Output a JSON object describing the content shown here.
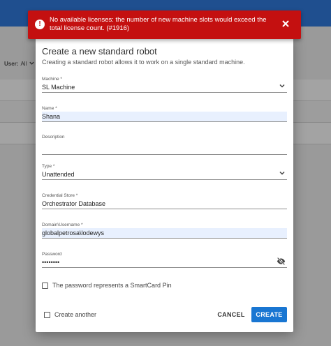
{
  "background": {
    "filter_label": "User:",
    "filter_value": "All"
  },
  "error": {
    "message": "No available licenses: the number of new machine slots would exceed the total license count. (#1916)"
  },
  "modal": {
    "title": "Create a new standard robot",
    "subtitle": "Creating a standard robot allows it to work on a single standard machine.",
    "fields": {
      "machine": {
        "label": "Machine *",
        "value": "SL Machine"
      },
      "name": {
        "label": "Name *",
        "value": "Shana"
      },
      "description": {
        "label": "Description",
        "value": ""
      },
      "type": {
        "label": "Type *",
        "value": "Unattended"
      },
      "credential_store": {
        "label": "Credential Store *",
        "value": "Orchestrator Database"
      },
      "domain_username": {
        "label": "Domain\\Username *",
        "value": "globalpetrosa\\lodewys"
      },
      "password": {
        "label": "Password",
        "value": "••••••••"
      }
    },
    "smartcard_label": "The password represents a SmartCard Pin",
    "create_another_label": "Create another",
    "cancel_label": "CANCEL",
    "create_label": "CREATE"
  }
}
